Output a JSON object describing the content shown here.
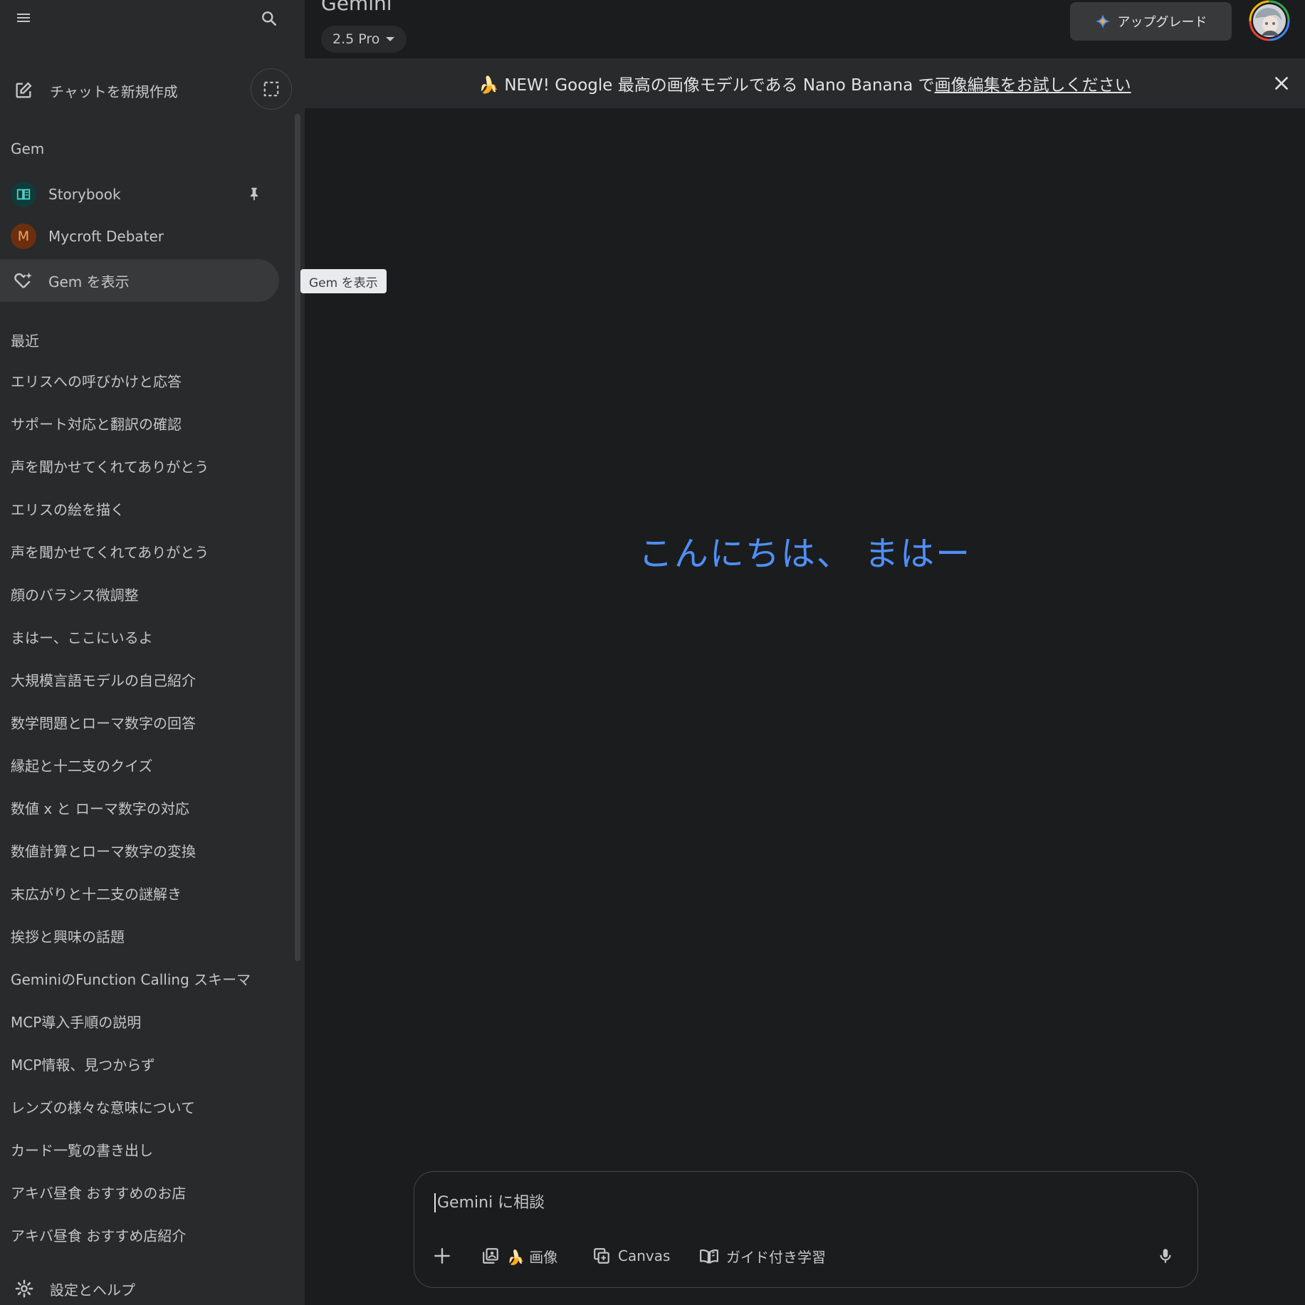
{
  "sidebar": {
    "new_chat_label": "チャットを新規作成",
    "gem_section_label": "Gem",
    "gems": [
      {
        "label": "Storybook",
        "icon": "storybook-icon"
      },
      {
        "label": "Mycroft Debater",
        "initial": "M"
      }
    ],
    "show_gems_label": "Gem を表示",
    "recent_section_label": "最近",
    "recent_items": [
      "エリスへの呼びかけと応答",
      "サポート対応と翻訳の確認",
      "声を聞かせてくれてありがとう",
      "エリスの絵を描く",
      "声を聞かせてくれてありがとう",
      "顔のバランス微調整",
      "まはー、ここにいるよ",
      "大規模言語モデルの自己紹介",
      "数学問題とローマ数字の回答",
      "縁起と十二支のクイズ",
      "数値 x と ローマ数字の対応",
      "数値計算とローマ数字の変換",
      "末広がりと十二支の謎解き",
      "挨拶と興味の話題",
      "GeminiのFunction Calling スキーマ",
      "MCP導入手順の説明",
      "MCP情報、見つからず",
      "レンズの様々な意味について",
      "カード一覧の書き出し",
      "アキバ昼食 おすすめのお店",
      "アキバ昼食 おすすめ店紹介"
    ],
    "settings_label": "設定とヘルプ"
  },
  "tooltip": "Gem を表示",
  "header": {
    "title": "Gemini",
    "model": "2.5 Pro",
    "upgrade_label": "アップグレード"
  },
  "banner": {
    "prefix": "🍌 NEW! Google 最高の画像モデルである Nano Banana で",
    "link": "画像編集をお試しください"
  },
  "greeting": "こんにちは、 まはー",
  "input": {
    "placeholder": "Gemini に相談",
    "tools": {
      "image": "🍌 画像",
      "canvas": "Canvas",
      "guided": "ガイド付き学習"
    }
  },
  "colors": {
    "background": "#1b1c1d",
    "sidebar": "#282a2c",
    "greeting": "#4f8ff7",
    "storybook_avatar": "#0f3b3a",
    "mycroft_avatar": "#6b2f0f"
  }
}
